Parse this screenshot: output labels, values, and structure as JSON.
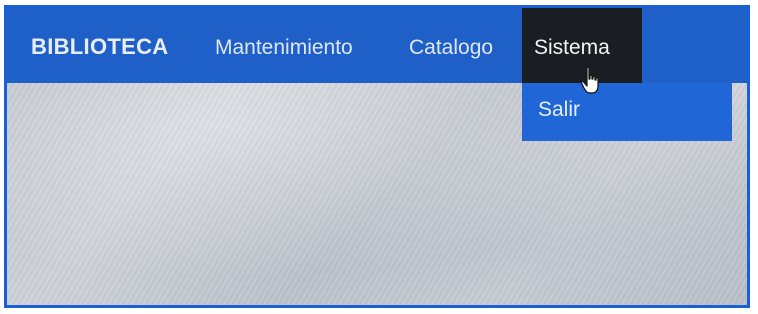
{
  "navbar": {
    "brand": "BIBLIOTECA",
    "items": [
      {
        "label": "Mantenimiento"
      },
      {
        "label": "Catalogo"
      },
      {
        "label": "Sistema",
        "active": true
      }
    ]
  },
  "dropdown": {
    "items": [
      {
        "label": "Salir"
      }
    ]
  },
  "colors": {
    "navbar_bg": "#1f5fc8",
    "active_item_bg": "#1a1d22",
    "dropdown_bg": "#2066d6",
    "frame_border": "#1a5fd6"
  },
  "icons": {
    "cursor": "hand-pointer-icon"
  }
}
